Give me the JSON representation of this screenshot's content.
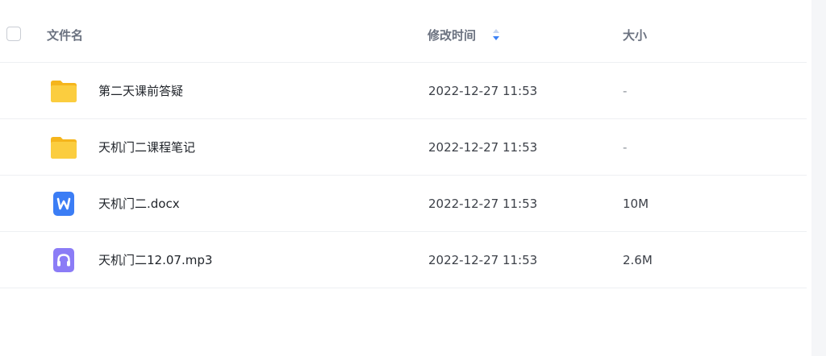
{
  "header": {
    "name_label": "文件名",
    "time_label": "修改时间",
    "size_label": "大小"
  },
  "colors": {
    "folder": "#f7c23b",
    "word": "#3b7df5",
    "audio": "#8b7cf6",
    "sort_accent": "#3b82f6"
  },
  "files": [
    {
      "name": "第二天课前答疑",
      "time": "2022-12-27 11:53",
      "size": "-",
      "icon": "folder-icon"
    },
    {
      "name": "天机门二课程笔记",
      "time": "2022-12-27 11:53",
      "size": "-",
      "icon": "folder-icon"
    },
    {
      "name": "天机门二.docx",
      "time": "2022-12-27 11:53",
      "size": "10M",
      "icon": "word-doc-icon"
    },
    {
      "name": "天机门二12.07.mp3",
      "time": "2022-12-27 11:53",
      "size": "2.6M",
      "icon": "audio-file-icon"
    }
  ]
}
